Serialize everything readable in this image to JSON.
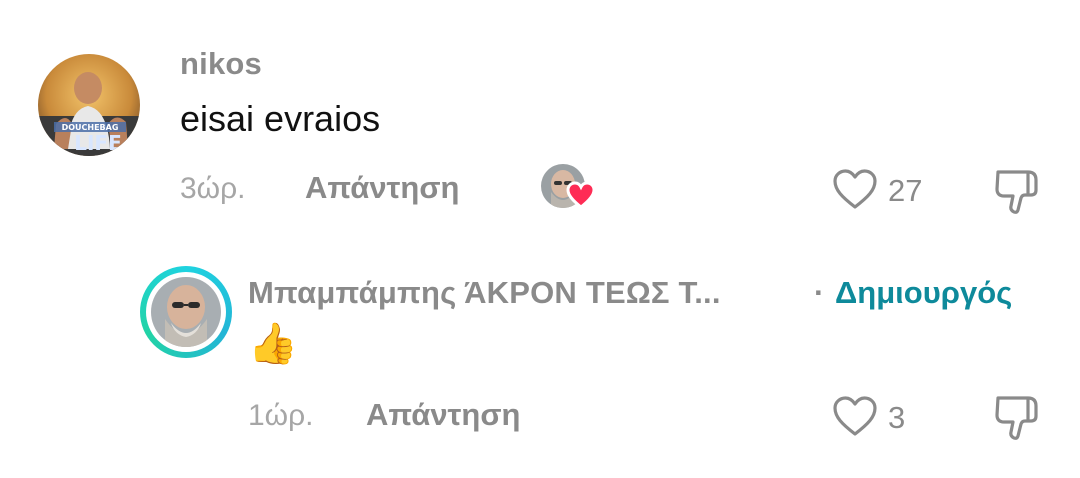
{
  "comment": {
    "username": "nikos",
    "text": "eisai evraios",
    "time": "3ώρ.",
    "reply_label": "Απάντηση",
    "like_count": "27",
    "avatar_icon": "user-avatar-icon",
    "creator_liked_icon": "creator-liked-heart-icon"
  },
  "reply": {
    "username": "Μπαμπάμπης ΆΚΡΟΝ ΤΕΩΣ Τ...",
    "separator": "·",
    "creator_label": "Δημιουργός",
    "text": "👍",
    "time": "1ώρ.",
    "reply_label": "Απάντηση",
    "like_count": "3"
  },
  "colors": {
    "accent": "#0e8a9b",
    "ring": "#1fd3e0",
    "heart": "#fe2c55",
    "muted": "#8a8a8a"
  }
}
